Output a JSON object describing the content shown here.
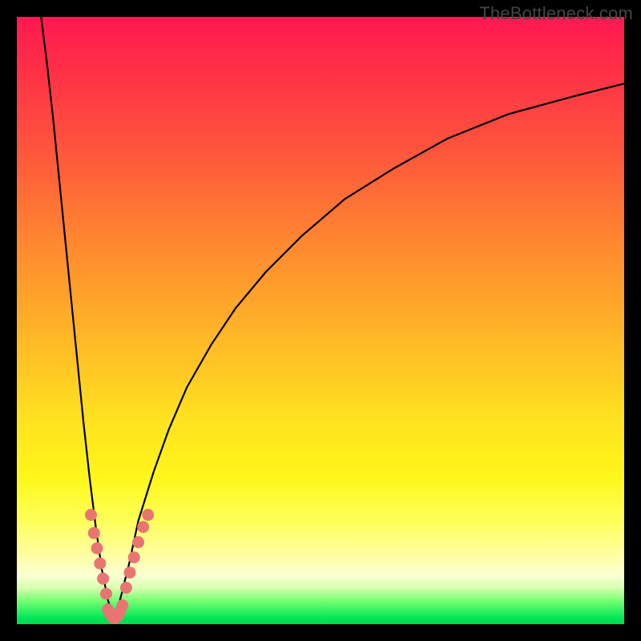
{
  "watermark": "TheBottleneck.com",
  "colors": {
    "frame": "#000000",
    "gradient_top": "#ff1850",
    "gradient_mid1": "#ff8a2f",
    "gradient_mid2": "#ffe11f",
    "gradient_pale": "#feffa0",
    "gradient_bottom": "#00db4f",
    "curve": "#000000",
    "marker": "#e97572"
  },
  "chart_data": {
    "type": "line",
    "title": "",
    "xlabel": "",
    "ylabel": "",
    "xlim": [
      0,
      100
    ],
    "ylim": [
      0,
      100
    ],
    "grid": false,
    "legend": false,
    "note": "V-shaped bottleneck curve. Left branch drops steeply from top-left to a minimum near x≈16, right branch rises with decreasing slope toward top-right. Values are bottleneck % (y) vs component scaling (x), read off the plotted curve; no numeric axes are shown so values are estimated from pixel position.",
    "series": [
      {
        "name": "left_branch",
        "x": [
          4.0,
          5.0,
          6.0,
          7.0,
          8.0,
          9.0,
          10.0,
          11.0,
          12.0,
          13.0,
          14.0,
          15.0,
          15.8
        ],
        "values": [
          100.0,
          92.0,
          83.0,
          73.0,
          63.0,
          53.0,
          43.0,
          33.0,
          24.0,
          16.0,
          9.0,
          4.0,
          1.0
        ]
      },
      {
        "name": "right_branch",
        "x": [
          15.8,
          17.0,
          18.5,
          20.0,
          22.5,
          25.0,
          28.0,
          32.0,
          36.0,
          41.0,
          47.0,
          54.0,
          62.0,
          71.0,
          81.0,
          92.0,
          100.0
        ],
        "values": [
          1.0,
          4.0,
          10.0,
          17.0,
          25.0,
          32.0,
          39.0,
          46.0,
          52.0,
          58.0,
          64.0,
          70.0,
          75.0,
          80.0,
          84.0,
          87.0,
          89.0
        ]
      },
      {
        "name": "markers_left",
        "x": [
          12.2,
          12.7,
          13.2,
          13.7,
          14.2,
          14.7
        ],
        "values": [
          18.0,
          15.0,
          12.5,
          10.0,
          7.5,
          5.0
        ]
      },
      {
        "name": "markers_bottom",
        "x": [
          15.0,
          15.4,
          15.8,
          16.2,
          16.6,
          17.0,
          17.4
        ],
        "values": [
          2.4,
          1.6,
          1.05,
          1.0,
          1.4,
          2.1,
          3.1
        ]
      },
      {
        "name": "markers_right",
        "x": [
          18.0,
          18.6,
          19.3,
          20.0,
          20.8,
          21.6
        ],
        "values": [
          6.0,
          8.5,
          11.0,
          13.5,
          16.0,
          18.0
        ]
      }
    ]
  }
}
